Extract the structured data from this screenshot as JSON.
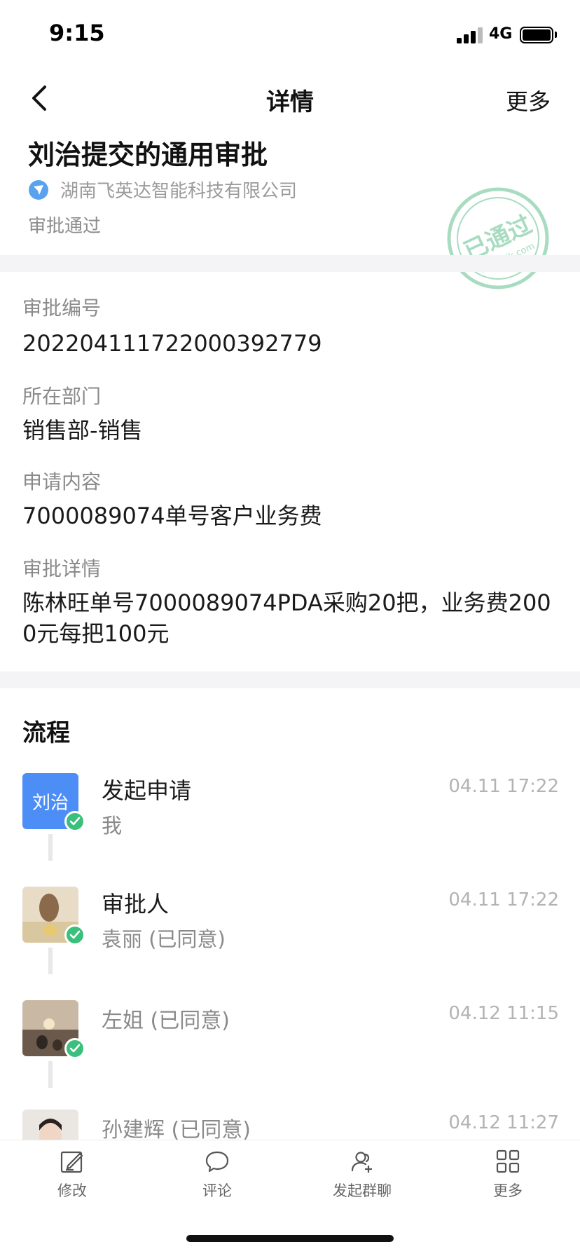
{
  "status_bar": {
    "time": "9:15",
    "network": "4G"
  },
  "nav": {
    "title": "详情",
    "more": "更多"
  },
  "header": {
    "title": "刘治提交的通用审批",
    "company": "湖南飞英达智能科技有限公司",
    "status": "审批通过",
    "stamp_text": "已通过",
    "stamp_site": "dingtalk.com"
  },
  "fields": [
    {
      "label": "审批编号",
      "value": "202204111722000392779"
    },
    {
      "label": "所在部门",
      "value": "销售部-销售"
    },
    {
      "label": "申请内容",
      "value": "7000089074单号客户业务费"
    },
    {
      "label": "审批详情",
      "value": "陈林旺单号7000089074PDA采购20把，业务费2000元每把100元"
    }
  ],
  "flow": {
    "title": "流程",
    "steps": [
      {
        "avatar_text": "刘治",
        "name": "发起申请",
        "sub": "我",
        "time": "04.11 17:22"
      },
      {
        "name": "审批人",
        "sub": "袁丽 (已同意)",
        "time": "04.11 17:22"
      },
      {
        "name": "左姐 (已同意)",
        "time": "04.12 11:15"
      },
      {
        "name": "孙建辉 (已同意)",
        "time": "04.12 11:27"
      }
    ]
  },
  "tabbar": {
    "items": [
      {
        "label": "修改",
        "icon": "edit-icon"
      },
      {
        "label": "评论",
        "icon": "comment-icon"
      },
      {
        "label": "发起群聊",
        "icon": "group-chat-icon"
      },
      {
        "label": "更多",
        "icon": "grid-icon"
      }
    ]
  },
  "colors": {
    "accent": "#4d8df6",
    "success": "#3bbf7c",
    "stamp": "#a8dcc0"
  }
}
